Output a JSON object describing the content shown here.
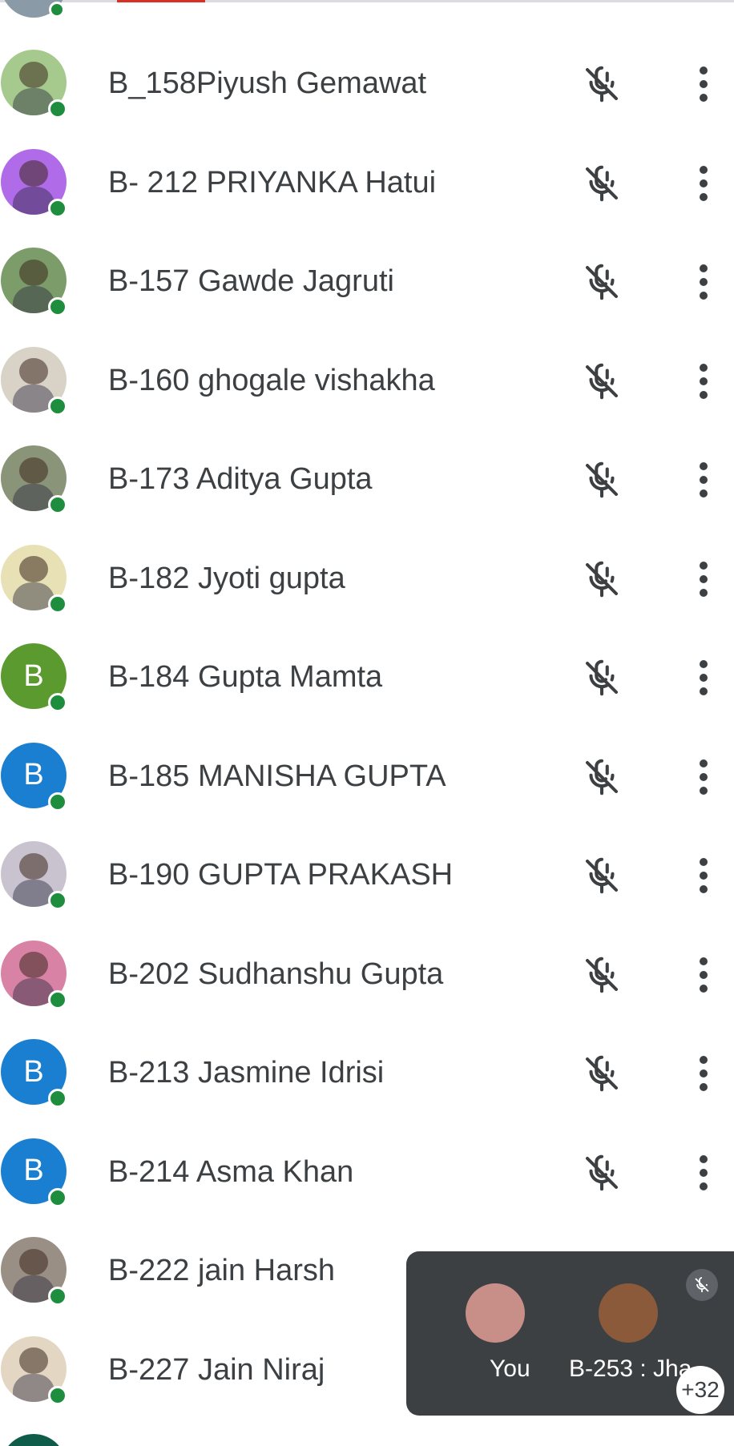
{
  "colors": {
    "online": "#1e8e3e",
    "text": "#3c4043",
    "icon": "#3c4043",
    "floating_bg": "#3c4043",
    "avatar_green": "#5a9a2e",
    "avatar_blue": "#1a7fd1"
  },
  "participants": [
    {
      "name": "B_158Piyush Gemawat",
      "avatar_type": "photo",
      "avatar_color": "#a6c98d"
    },
    {
      "name": "B- 212 PRIYANKA Hatui",
      "avatar_type": "photo",
      "avatar_color": "#b06be8"
    },
    {
      "name": "B-157 Gawde Jagruti",
      "avatar_type": "photo",
      "avatar_color": "#7c9d6a"
    },
    {
      "name": "B-160 ghogale vishakha",
      "avatar_type": "photo",
      "avatar_color": "#d9d2c7"
    },
    {
      "name": "B-173 Aditya Gupta",
      "avatar_type": "photo",
      "avatar_color": "#8a9478"
    },
    {
      "name": "B-182 Jyoti gupta",
      "avatar_type": "photo",
      "avatar_color": "#e7e1b5"
    },
    {
      "name": "B-184 Gupta Mamta",
      "avatar_type": "letter",
      "avatar_letter": "B",
      "avatar_color": "#5a9a2e"
    },
    {
      "name": "B-185 MANISHA GUPTA",
      "avatar_type": "letter",
      "avatar_letter": "B",
      "avatar_color": "#1a7fd1"
    },
    {
      "name": "B-190 GUPTA PRAKASH",
      "avatar_type": "photo",
      "avatar_color": "#c9c3cf"
    },
    {
      "name": "B-202 Sudhanshu Gupta",
      "avatar_type": "photo",
      "avatar_color": "#d883a6"
    },
    {
      "name": "B-213 Jasmine Idrisi",
      "avatar_type": "letter",
      "avatar_letter": "B",
      "avatar_color": "#1a7fd1"
    },
    {
      "name": "B-214 Asma Khan",
      "avatar_type": "letter",
      "avatar_letter": "B",
      "avatar_color": "#1a7fd1"
    },
    {
      "name": "B-222 jain Harsh",
      "avatar_type": "photo",
      "avatar_color": "#9a8f84"
    },
    {
      "name": "B-227 Jain Niraj",
      "avatar_type": "photo",
      "avatar_color": "#e3d7c3"
    }
  ],
  "icons": {
    "mic": "mic-off-icon",
    "more": "more-vert-icon"
  },
  "floating_panel": {
    "tiles": [
      {
        "label": "You",
        "avatar_color": "#c78f87"
      },
      {
        "label": "B-253 : Jha",
        "avatar_color": "#8a5a3a"
      }
    ],
    "more_count": "+32"
  }
}
